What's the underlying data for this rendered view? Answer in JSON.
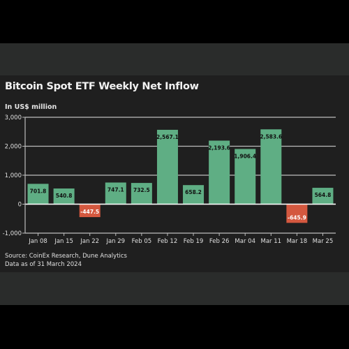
{
  "chart_data": {
    "type": "bar",
    "title": "Bitcoin Spot ETF Weekly Net Inflow",
    "ylabel": "In US$ million",
    "categories": [
      "Jan 08",
      "Jan 15",
      "Jan 22",
      "Jan 29",
      "Feb 05",
      "Feb 12",
      "Feb 19",
      "Feb 26",
      "Mar 04",
      "Mar 11",
      "Mar 18",
      "Mar 25"
    ],
    "values": [
      701.8,
      540.8,
      -447.5,
      747.1,
      732.5,
      2567.1,
      658.2,
      2193.6,
      1906.4,
      2583.6,
      -645.9,
      564.8
    ],
    "data_labels": [
      "701.8",
      "540.8",
      "-447.5",
      "747.1",
      "732.5",
      "2,567.1",
      "658.2",
      "2,193.6",
      "1,906.4",
      "2,583.6",
      "-645.9",
      "564.8"
    ],
    "ylim": [
      -1000,
      3000
    ],
    "yticks": [
      3000,
      2000,
      1000,
      0,
      -1000
    ],
    "ytick_labels": [
      "3,000",
      "2,000",
      "1,000",
      "0",
      "-1,000"
    ],
    "grid": true,
    "colors": {
      "positive": "#5fae84",
      "negative": "#d4583f",
      "background": "#1f1f1f"
    },
    "source": "Source: CoinEx Research, Dune Analytics",
    "note": "Data as of 31 March 2024"
  }
}
